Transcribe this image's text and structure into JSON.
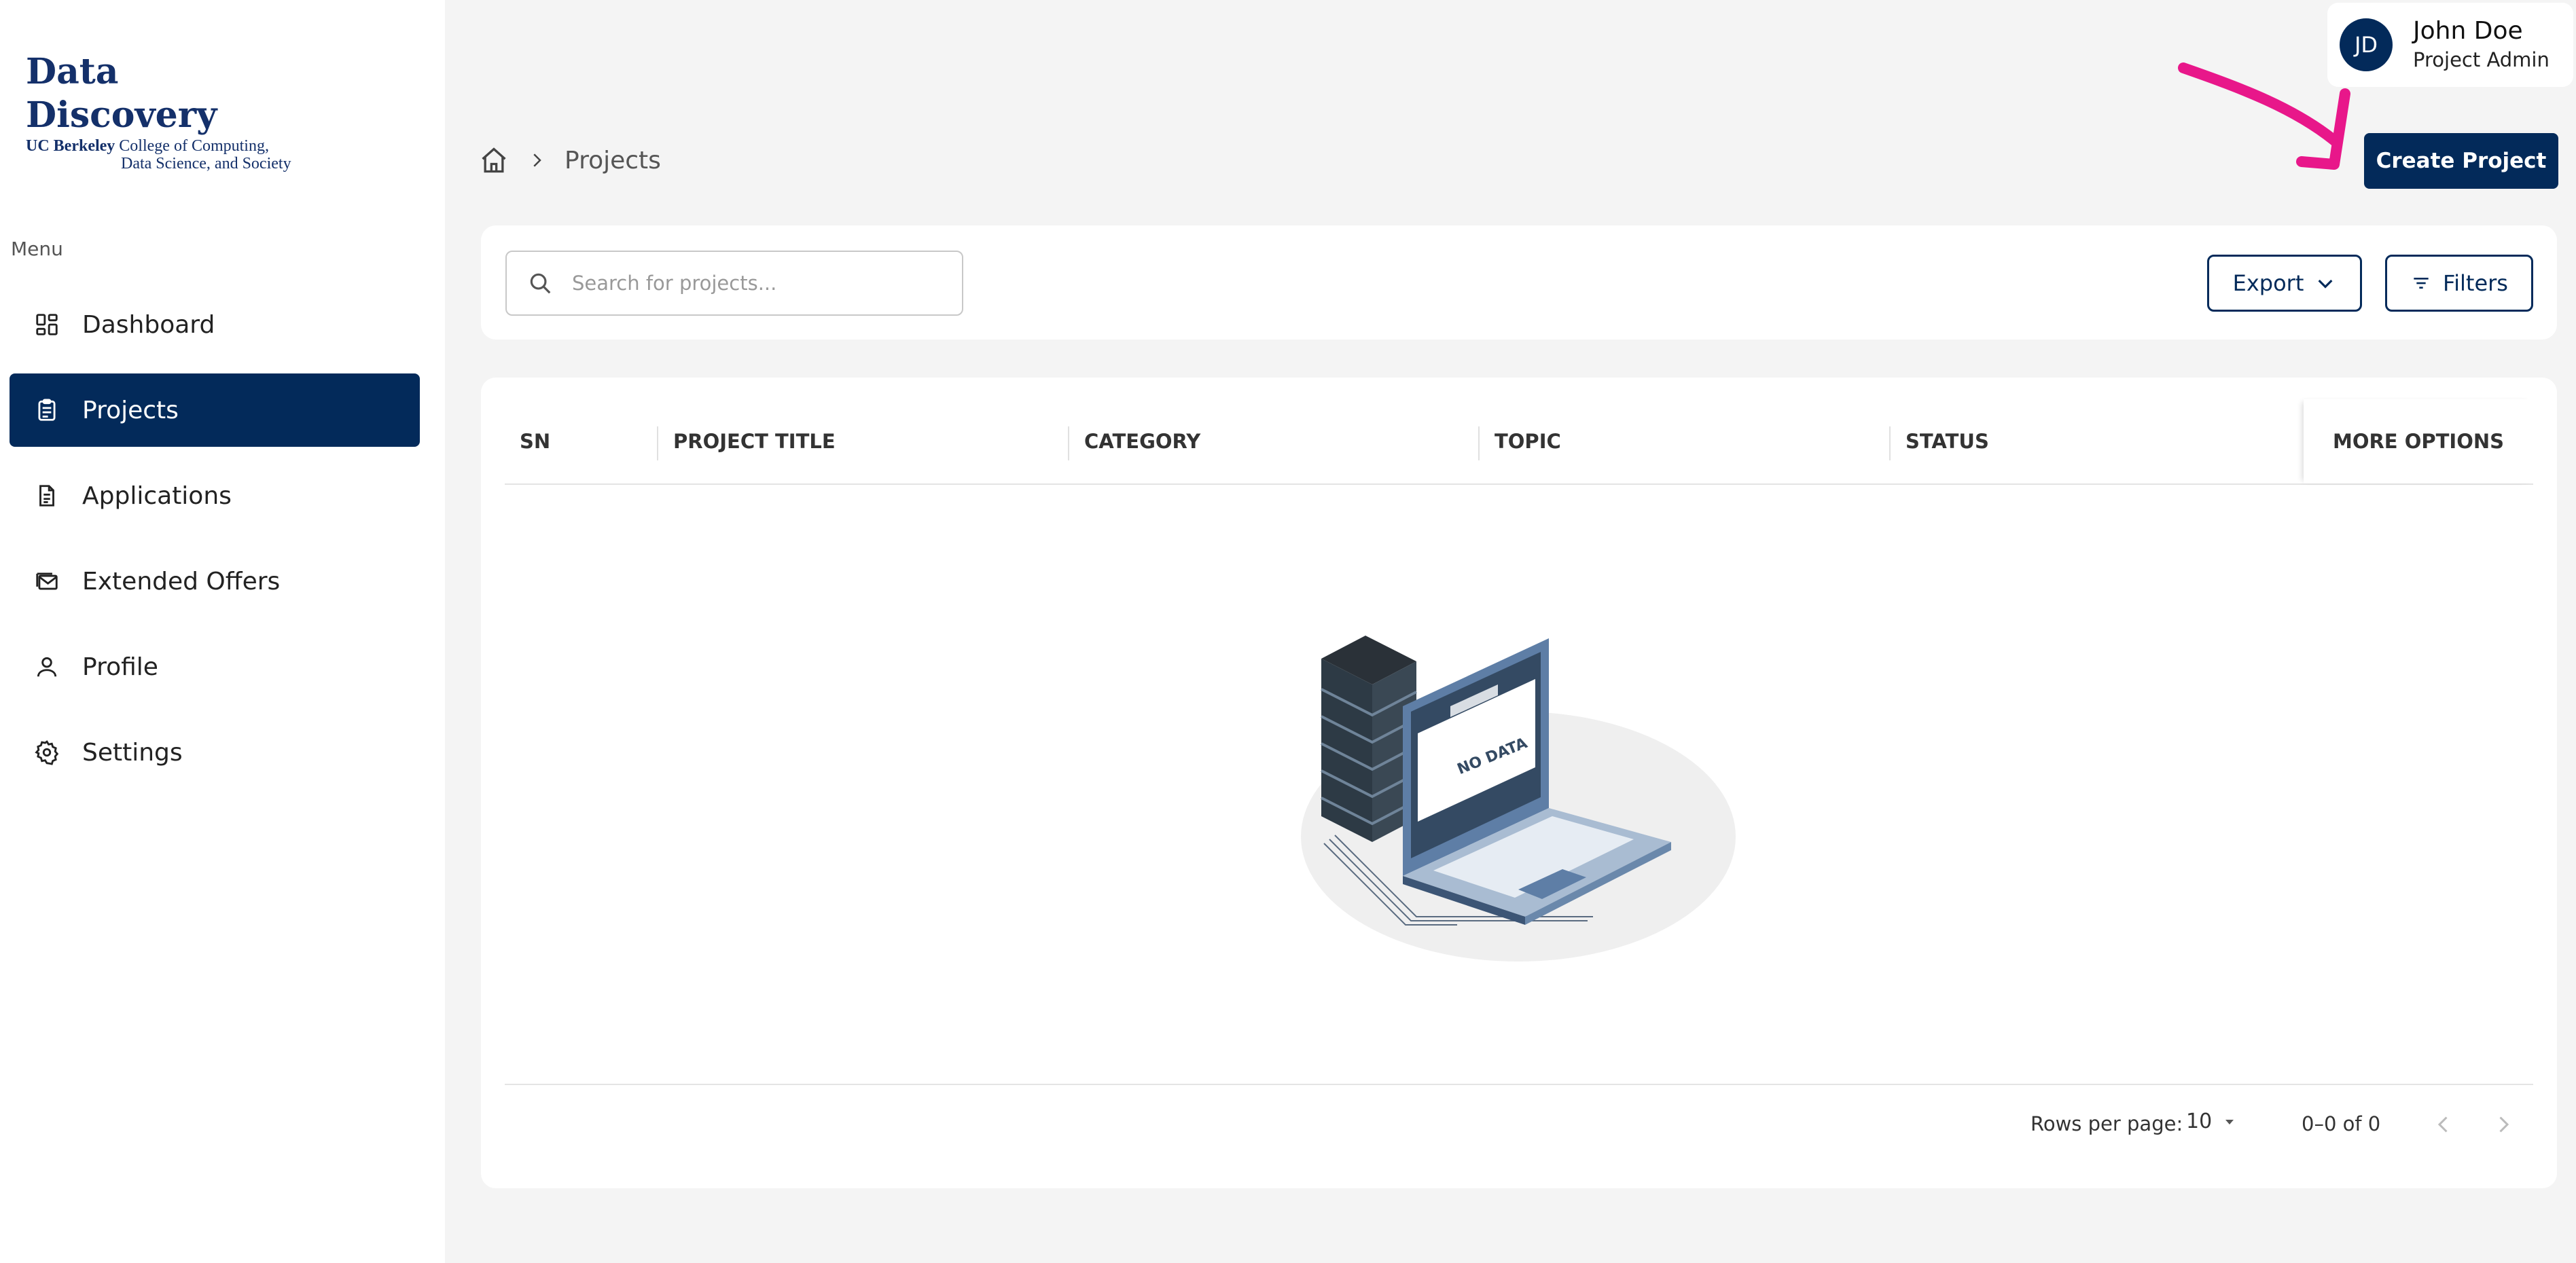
{
  "brand": {
    "title": "Data Discovery",
    "subtitle_bold": "UC Berkeley",
    "subtitle_line1": "College of Computing,",
    "subtitle_line2": "Data Science, and Society"
  },
  "sidebar": {
    "menu_label": "Menu",
    "items": [
      {
        "label": "Dashboard",
        "icon": "dashboard-icon"
      },
      {
        "label": "Projects",
        "icon": "clipboard-icon",
        "active": true
      },
      {
        "label": "Applications",
        "icon": "document-icon"
      },
      {
        "label": "Extended Offers",
        "icon": "mail-stack-icon"
      },
      {
        "label": "Profile",
        "icon": "person-icon"
      },
      {
        "label": "Settings",
        "icon": "gear-icon"
      }
    ]
  },
  "breadcrumb": {
    "current": "Projects"
  },
  "user": {
    "initials": "JD",
    "name": "John Doe",
    "role": "Project Admin"
  },
  "actions": {
    "create_label": "Create Project",
    "export_label": "Export",
    "filters_label": "Filters"
  },
  "search": {
    "placeholder": "Search for projects..."
  },
  "table": {
    "columns": [
      "SN",
      "PROJECT TITLE",
      "CATEGORY",
      "TOPIC",
      "STATUS"
    ],
    "more_options": "MORE OPTIONS",
    "empty_text": "NO DATA",
    "rows": []
  },
  "pagination": {
    "rows_per_page_label": "Rows per page:",
    "rows_per_page": "10",
    "range": "0–0 of 0"
  },
  "colors": {
    "primary": "#032a5a",
    "annotation_arrow": "#e8178a",
    "background": "#f4f4f4"
  }
}
